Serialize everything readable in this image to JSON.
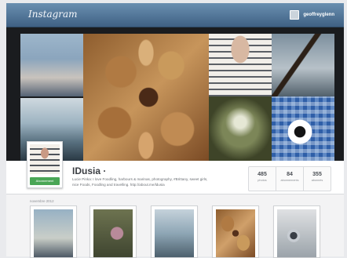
{
  "app": {
    "logo": "Instagram"
  },
  "header": {
    "username": "geoffreyglenn"
  },
  "profile": {
    "name": "IDusia ·",
    "bio_lines": [
      "Lucie Pinka: I love Foodling, harbours & marinas, photography, #Brittany, sweet girls,",
      "nice Foods, Foodling and travelling. http://about.me/ldusia"
    ],
    "follow_label": "Abonnement",
    "stats": [
      {
        "value": "485",
        "label": "photos"
      },
      {
        "value": "84",
        "label": "abonnements"
      },
      {
        "value": "355",
        "label": "abonnés"
      }
    ]
  },
  "feed": {
    "month": "novembre 2012"
  },
  "icons": {
    "user": "user-avatar-icon"
  },
  "colors": {
    "topbar": "#4c6f92",
    "follow": "#4aa656"
  }
}
